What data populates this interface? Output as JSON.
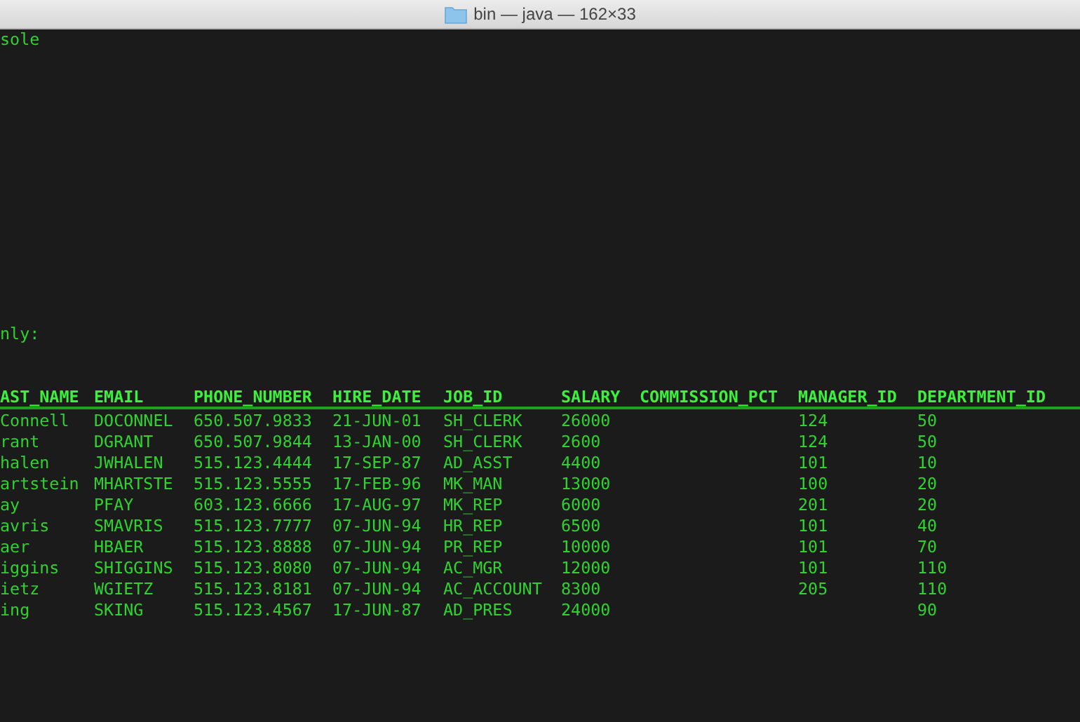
{
  "window": {
    "title": "bin — java — 162×33"
  },
  "console_lines": [
    "sole",
    "nly:"
  ],
  "table": {
    "columns": [
      "AST_NAME",
      "EMAIL",
      "PHONE_NUMBER",
      "HIRE_DATE",
      "JOB_ID",
      "SALARY",
      "COMMISSION_PCT",
      "MANAGER_ID",
      "DEPARTMENT_ID"
    ],
    "rows": [
      [
        "Connell",
        "DOCONNEL",
        "650.507.9833",
        "21-JUN-01",
        "SH_CLERK",
        "26000",
        null,
        "124",
        "50"
      ],
      [
        "rant",
        "DGRANT",
        "650.507.9844",
        "13-JAN-00",
        "SH_CLERK",
        "2600",
        null,
        "124",
        "50"
      ],
      [
        "halen",
        "JWHALEN",
        "515.123.4444",
        "17-SEP-87",
        "AD_ASST",
        "4400",
        null,
        "101",
        "10"
      ],
      [
        "artstein",
        "MHARTSTE",
        "515.123.5555",
        "17-FEB-96",
        "MK_MAN",
        "13000",
        null,
        "100",
        "20"
      ],
      [
        "ay",
        "PFAY",
        "603.123.6666",
        "17-AUG-97",
        "MK_REP",
        "6000",
        null,
        "201",
        "20"
      ],
      [
        "avris",
        "SMAVRIS",
        "515.123.7777",
        "07-JUN-94",
        "HR_REP",
        "6500",
        null,
        "101",
        "40"
      ],
      [
        "aer",
        "HBAER",
        "515.123.8888",
        "07-JUN-94",
        "PR_REP",
        "10000",
        null,
        "101",
        "70"
      ],
      [
        "iggins",
        "SHIGGINS",
        "515.123.8080",
        "07-JUN-94",
        "AC_MGR",
        "12000",
        null,
        "101",
        "110"
      ],
      [
        "ietz",
        "WGIETZ",
        "515.123.8181",
        "07-JUN-94",
        "AC_ACCOUNT",
        "8300",
        null,
        "205",
        "110"
      ],
      [
        "ing",
        "SKING",
        "515.123.4567",
        "17-JUN-87",
        "AD_PRES",
        "24000",
        null,
        null,
        "90"
      ]
    ]
  }
}
